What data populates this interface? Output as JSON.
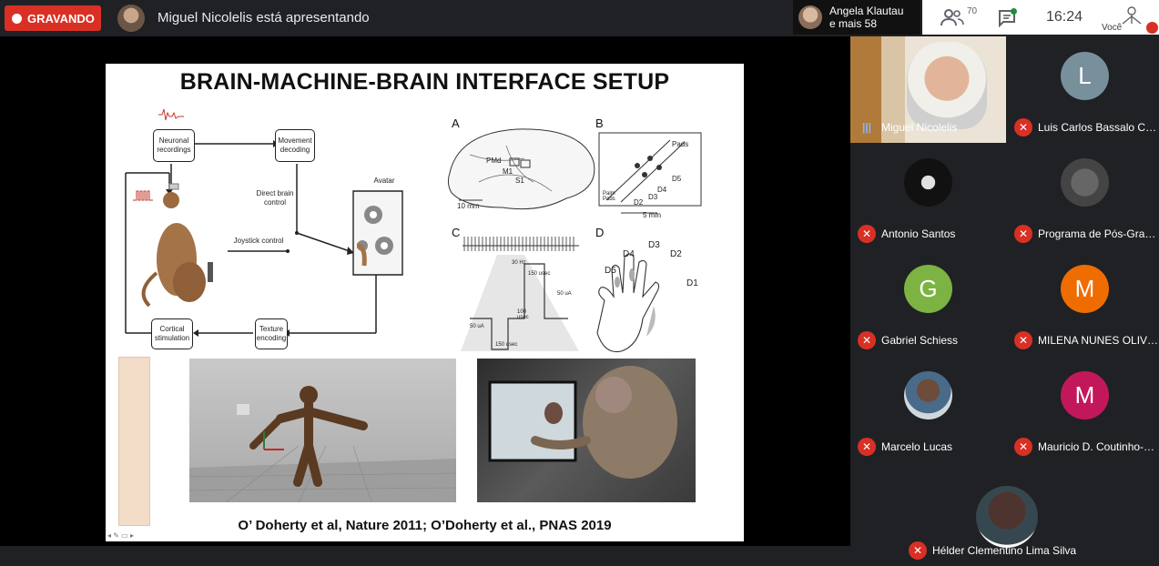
{
  "topbar": {
    "recording_label": "GRAVANDO",
    "presenting_text": "Miguel Nicolelis está apresentando",
    "viewer_name": "Angela Klautau",
    "viewer_more": "e mais 58",
    "people_count": "70",
    "time": "16:24",
    "self_label": "Você"
  },
  "slide": {
    "title": "BRAIN-MACHINE-BRAIN INTERFACE SETUP",
    "citation": "O’ Doherty et al, Nature 2011; O’Doherty et al., PNAS 2019",
    "diagram": {
      "neuronal_recordings": "Neuronal recordings",
      "movement_decoding": "Movement decoding",
      "direct_brain_control": "Direct brain control",
      "joystick_control": "Joystick control",
      "avatar": "Avatar",
      "cortical_stimulation": "Cortical stimulation",
      "texture_encoding": "Texture encoding"
    },
    "panels": {
      "a": "A",
      "b": "B",
      "c": "C",
      "d": "D",
      "a_labels": [
        "PMd",
        "M1",
        "S1",
        "10 mm"
      ],
      "b_labels": [
        "Pads",
        "D5",
        "D4",
        "D3",
        "D2",
        "Palm Pads",
        "5 mm"
      ],
      "c_labels": [
        "30 Hz",
        "150 usec",
        "50 uA",
        "100 usec",
        "50 uA",
        "150 usec"
      ],
      "d_labels": [
        "D4",
        "D3",
        "D2",
        "D5",
        "D1"
      ]
    }
  },
  "participants": [
    {
      "name": "Miguel Nicolelis",
      "talking": true,
      "video": true
    },
    {
      "name": "Luis Carlos Bassalo Cri...",
      "initial": "L",
      "color": "#78909c"
    },
    {
      "name": "Antonio Santos",
      "photo": true
    },
    {
      "name": "Programa de Pós-Grad...",
      "photo": true
    },
    {
      "name": "Gabriel Schiess",
      "initial": "G",
      "color": "#7cb342"
    },
    {
      "name": "MILENA NUNES OLIVEI...",
      "initial": "M",
      "color": "#ef6c00"
    },
    {
      "name": "Marcelo Lucas",
      "photo": true
    },
    {
      "name": "Mauricio D. Coutinho-Fi...",
      "initial": "M",
      "color": "#c2185b"
    },
    {
      "name": "Hélder Clementino Lima Silva",
      "photo": true
    }
  ]
}
